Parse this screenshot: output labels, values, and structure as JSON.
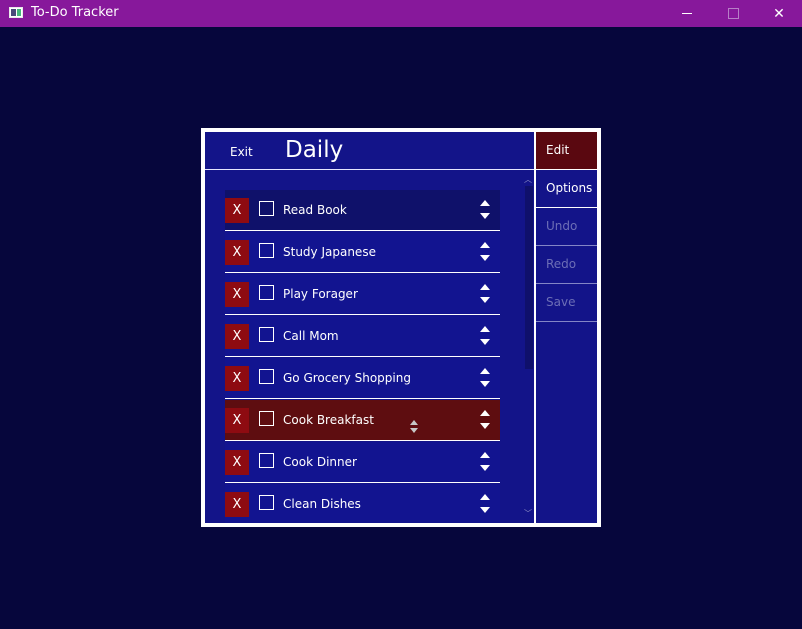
{
  "window": {
    "title": "To-Do Tracker",
    "minimize_icon": "minimize-icon",
    "maximize_icon": "maximize-icon",
    "close_label": "✕"
  },
  "header": {
    "exit_label": "Exit",
    "list_title": "Daily"
  },
  "items": [
    {
      "delete_label": "X",
      "label": "Read Book",
      "checked": false
    },
    {
      "delete_label": "X",
      "label": "Study Japanese",
      "checked": false
    },
    {
      "delete_label": "X",
      "label": "Play Forager",
      "checked": false
    },
    {
      "delete_label": "X",
      "label": "Call Mom",
      "checked": false
    },
    {
      "delete_label": "X",
      "label": "Go Grocery Shopping",
      "checked": false
    },
    {
      "delete_label": "X",
      "label": "Cook Breakfast",
      "checked": false
    },
    {
      "delete_label": "X",
      "label": "Cook Dinner",
      "checked": false
    },
    {
      "delete_label": "X",
      "label": "Clean Dishes",
      "checked": false
    }
  ],
  "sidebar": {
    "edit": "Edit",
    "options": "Options",
    "undo": "Undo",
    "redo": "Redo",
    "save": "Save"
  },
  "colors": {
    "background": "#06063c",
    "titlebar": "#87189b",
    "panel": "#131489",
    "delete_button": "#8e0b11",
    "edit_active": "#5a0810",
    "hover_row": "#5e0d10"
  }
}
